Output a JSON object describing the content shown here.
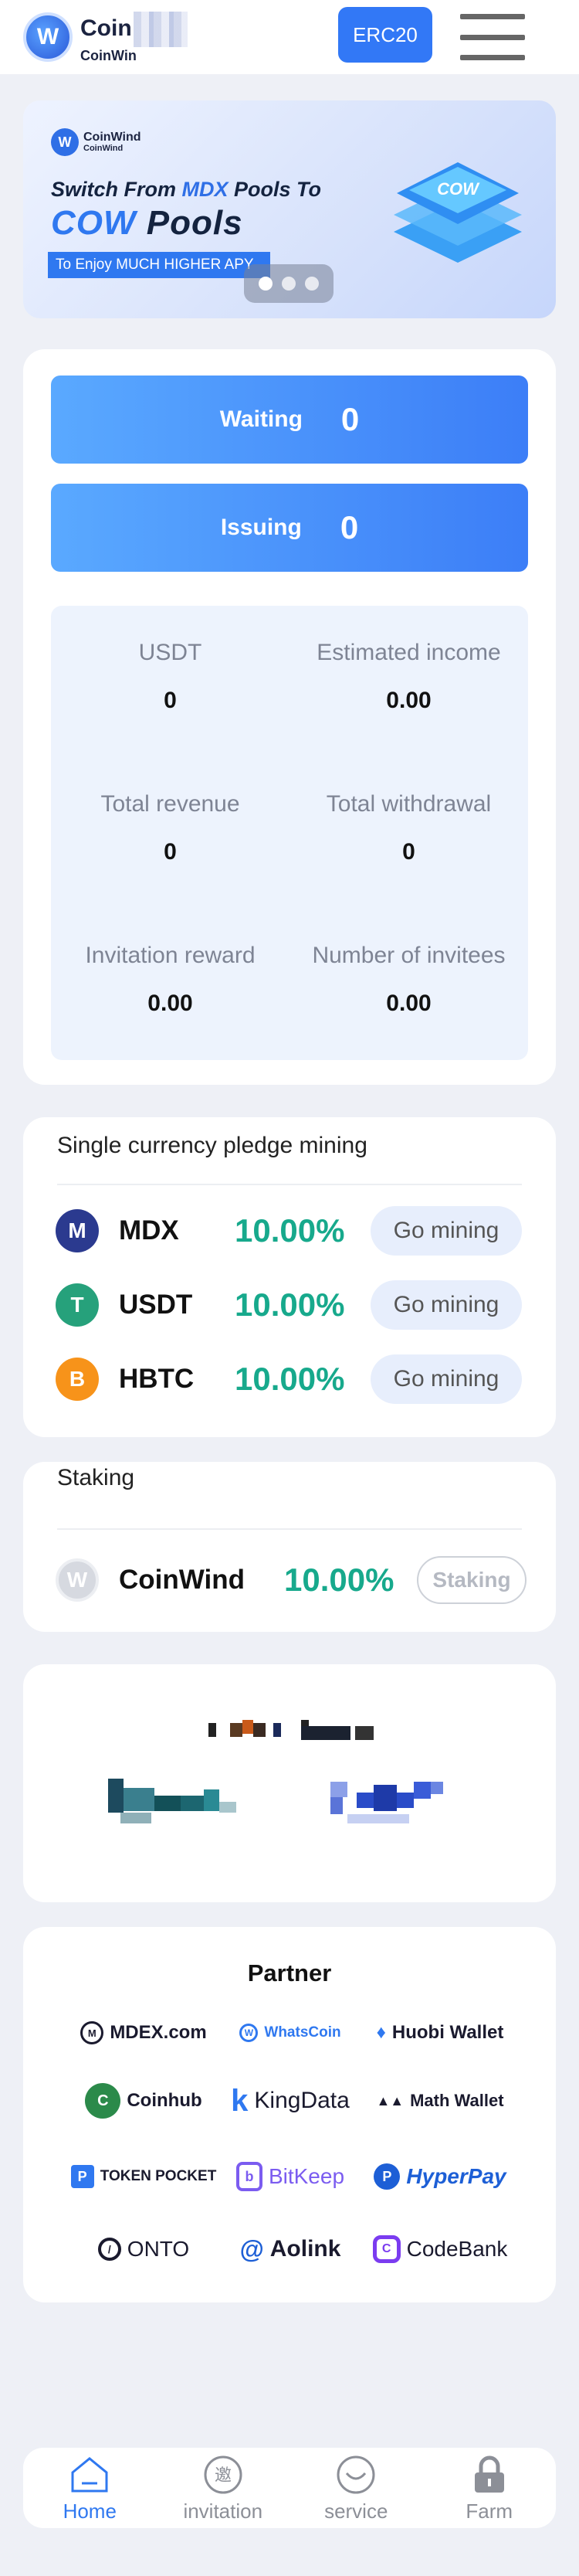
{
  "header": {
    "logo_line1": "Coin",
    "logo_line2": "CoinWin",
    "network_button": "ERC20"
  },
  "banner": {
    "logo_name": "CoinWind",
    "logo_sub": "CoinWind",
    "line1_a": "Switch From ",
    "line1_b": "MDX",
    "line1_c": " Pools To",
    "line2_a": "COW",
    "line2_b": " Pools",
    "line3": "To Enjoy MUCH HIGHER APY",
    "cube_label": "COW",
    "slides": 3,
    "active_slide": 1
  },
  "stats": {
    "waiting_label": "Waiting",
    "waiting_value": "0",
    "issuing_label": "Issuing",
    "issuing_value": "0",
    "cells": [
      {
        "label": "USDT",
        "value": "0"
      },
      {
        "label": "Estimated income",
        "value": "0.00"
      },
      {
        "label": "Total revenue",
        "value": "0"
      },
      {
        "label": "Total withdrawal",
        "value": "0"
      },
      {
        "label": "Invitation reward",
        "value": "0.00"
      },
      {
        "label": "Number of invitees",
        "value": "0.00"
      }
    ]
  },
  "pledge": {
    "title": "Single currency pledge mining",
    "items": [
      {
        "coin": "MDX",
        "rate": "10.00%",
        "action": "Go mining",
        "color": "#2b3a8f",
        "icon": "mdx-icon"
      },
      {
        "coin": "USDT",
        "rate": "10.00%",
        "action": "Go mining",
        "color": "#26a17b",
        "icon": "usdt-icon"
      },
      {
        "coin": "HBTC",
        "rate": "10.00%",
        "action": "Go mining",
        "color": "#f7931a",
        "icon": "hbtc-icon"
      }
    ]
  },
  "staking": {
    "title": "Staking",
    "coin": "CoinWind",
    "rate": "10.00%",
    "action": "Staking"
  },
  "partner": {
    "title": "Partner",
    "logos": [
      {
        "name": "MDEX.com",
        "color": "#1a1a2e",
        "icon": "mdex-icon"
      },
      {
        "name": "WhatsCoin",
        "color": "#2f78f0",
        "icon": "whatscoin-icon"
      },
      {
        "name": "Huobi Wallet",
        "color": "#1a1a2e",
        "icon": "huobi-icon"
      },
      {
        "name": "Coinhub",
        "color": "#1a1a2e",
        "icon": "coinhub-icon"
      },
      {
        "name": "KingData",
        "color": "#1a1a2e",
        "icon": "kingdata-icon"
      },
      {
        "name": "Math Wallet",
        "color": "#1a1a2e",
        "icon": "mathwallet-icon"
      },
      {
        "name": "TOKEN POCKET",
        "color": "#1a1a2e",
        "icon": "tokenpocket-icon"
      },
      {
        "name": "BitKeep",
        "color": "#7b5cf0",
        "icon": "bitkeep-icon"
      },
      {
        "name": "HyperPay",
        "color": "#1d5fd6",
        "icon": "hyperpay-icon"
      },
      {
        "name": "ONTO",
        "color": "#1a1a2e",
        "icon": "onto-icon"
      },
      {
        "name": "Aolink",
        "color": "#1a1a2e",
        "icon": "aolink-icon"
      },
      {
        "name": "CodeBank",
        "color": "#1a1a2e",
        "icon": "codebank-icon"
      }
    ]
  },
  "tabbar": {
    "tabs": [
      {
        "label": "Home",
        "icon": "home-icon",
        "active": true
      },
      {
        "label": "invitation",
        "icon": "invitation-icon",
        "active": false
      },
      {
        "label": "service",
        "icon": "service-icon",
        "active": false
      },
      {
        "label": "Farm",
        "icon": "lock-icon",
        "active": false
      }
    ]
  },
  "colors": {
    "accent": "#3278f6",
    "rate_green": "#17a98c",
    "page_bg": "#eef0f6"
  }
}
